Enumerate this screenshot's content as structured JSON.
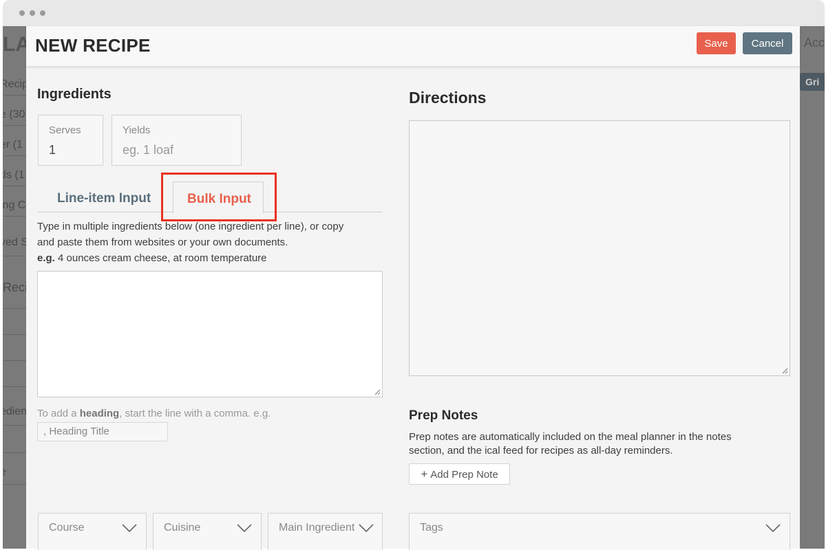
{
  "background_app": {
    "logo": "LA",
    "account": "Acc",
    "grid_button": "Gri",
    "sidebar_fragments": [
      "Recipe",
      "e (30",
      "er (1",
      "ds (1",
      "ing C",
      "ved S",
      "Reci",
      "edien",
      "e"
    ]
  },
  "modal": {
    "title": "NEW RECIPE",
    "save_label": "Save",
    "cancel_label": "Cancel"
  },
  "ingredients": {
    "heading": "Ingredients",
    "serves": {
      "label": "Serves",
      "value": "1"
    },
    "yields": {
      "label": "Yields",
      "placeholder": "eg. 1 loaf"
    },
    "tabs": [
      {
        "label": "Line-item Input",
        "active": false
      },
      {
        "label": "Bulk Input",
        "active": true
      }
    ],
    "help_line1": "Type in multiple ingredients below (one ingredient per line), or copy",
    "help_line2": "and paste them from websites or your own documents.",
    "example_prefix": "e.g.",
    "example_text": "4 ounces cream cheese, at room temperature",
    "bulk_value": "",
    "heading_hint_pre": "To add a ",
    "heading_hint_bold": "heading",
    "heading_hint_post": ", start the line with a comma. e.g.",
    "heading_example": ", Heading Title"
  },
  "directions": {
    "heading": "Directions",
    "value": ""
  },
  "prep_notes": {
    "heading": "Prep Notes",
    "description": "Prep notes are automatically included on the meal planner in the notes section, and the ical feed for recipes as all-day reminders.",
    "add_button": "Add Prep Note"
  },
  "selects": {
    "course": "Course",
    "cuisine": "Cuisine",
    "main_ingredient": "Main Ingredient",
    "tags": "Tags"
  },
  "colors": {
    "accent": "#e8604c",
    "secondary": "#5f7682",
    "highlight_box": "#e8321f"
  },
  "icons": {
    "dropdown": "chevron-down-icon",
    "add": "plus-icon",
    "resize": "resize-handle-icon"
  }
}
